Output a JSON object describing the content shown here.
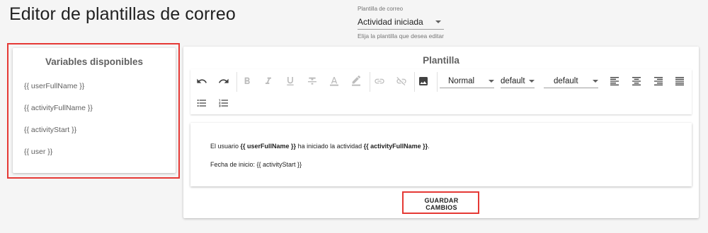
{
  "page": {
    "title": "Editor de plantillas de correo"
  },
  "template_select": {
    "label": "Plantilla de correo",
    "value": "Actividad iniciada",
    "hint": "Elija la plantilla que desea editar"
  },
  "variables": {
    "title": "Variables disponibles",
    "items": [
      "{{ userFullName }}",
      "{{ activityFullName }}",
      "{{ activityStart }}",
      "{{ user }}"
    ]
  },
  "editor_card": {
    "title": "Plantilla",
    "toolbar": {
      "format_value": "Normal",
      "font_value": "default",
      "size_value": "default",
      "icons": [
        "undo-icon",
        "redo-icon",
        "bold-icon",
        "italic-icon",
        "underline-icon",
        "strikethrough-icon",
        "text-color-icon",
        "highlight-icon",
        "link-icon",
        "unlink-icon",
        "image-icon",
        "align-left-icon",
        "align-center-icon",
        "align-right-icon",
        "align-justify-icon",
        "bulleted-list-icon",
        "numbered-list-icon"
      ]
    },
    "content": {
      "line1_prefix": "El usuario ",
      "line1_var1": "{{ userFullName }}",
      "line1_mid": " ha iniciado la actividad ",
      "line1_var2": "{{ activityFullName }}",
      "line1_suffix": ".",
      "line2": "Fecha de inicio: {{ activityStart }}"
    },
    "save_label": "GUARDAR CAMBIOS"
  },
  "colors": {
    "highlight": "#e53935",
    "icon_active": "#424242",
    "icon_disabled": "#bdbdbd"
  }
}
